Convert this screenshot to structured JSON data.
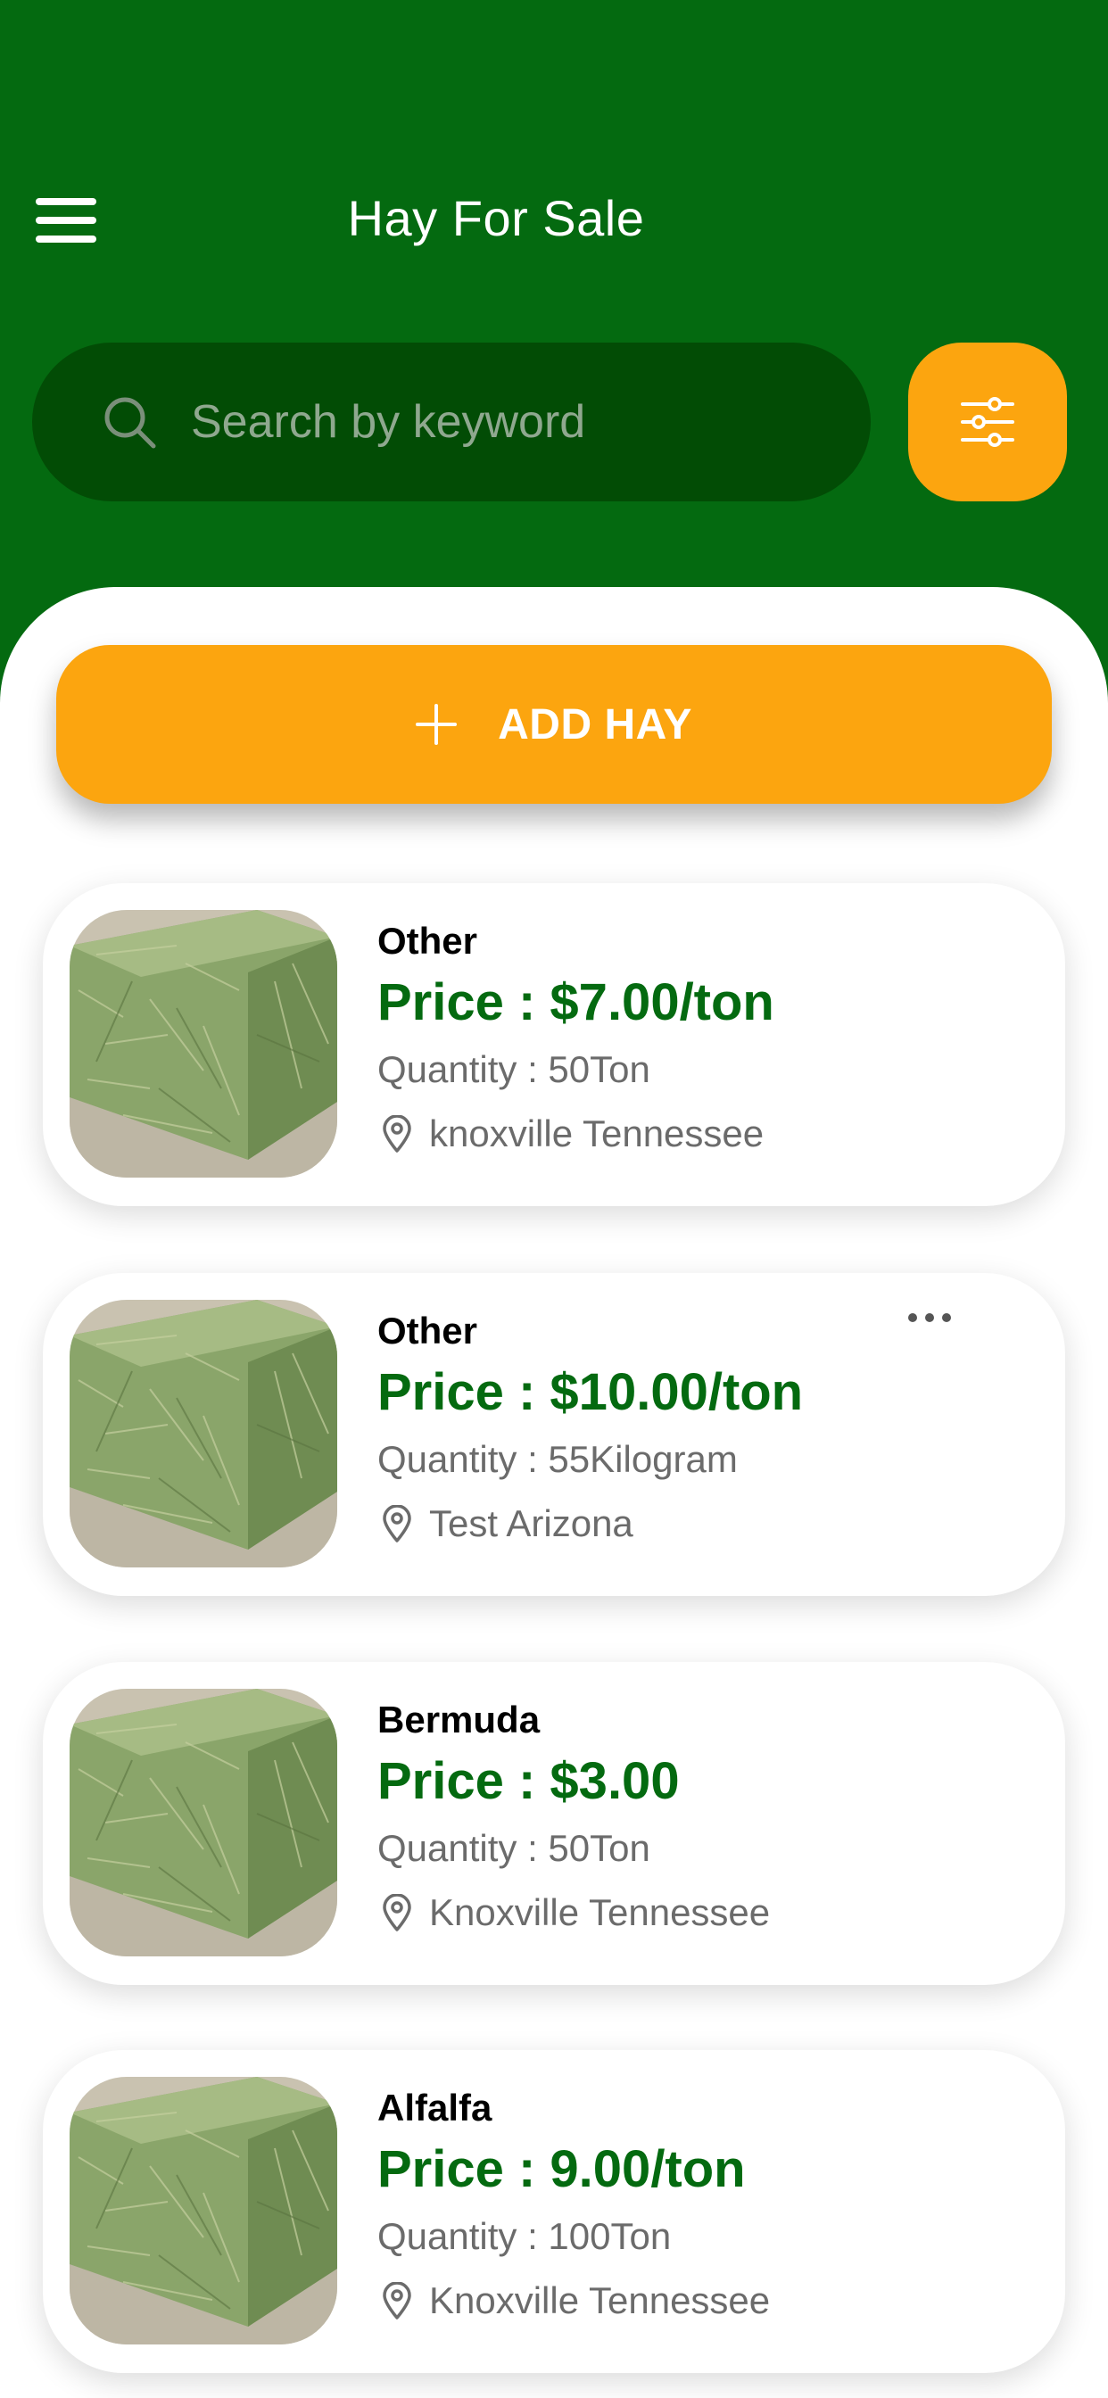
{
  "header": {
    "title": "Hay For Sale",
    "menu_icon": "hamburger-menu-icon"
  },
  "search": {
    "placeholder": "Search by keyword",
    "icon": "search-icon",
    "filter_icon": "filter-sliders-icon"
  },
  "add_button": {
    "label": "ADD HAY",
    "icon": "plus-icon"
  },
  "listings": [
    {
      "type": "Other",
      "price": "Price : $7.00/ton",
      "quantity": "Quantity : 50Ton",
      "location": "knoxville Tennessee",
      "has_menu": false
    },
    {
      "type": "Other",
      "price": "Price : $10.00/ton",
      "quantity": "Quantity : 55Kilogram",
      "location": "Test Arizona",
      "has_menu": true
    },
    {
      "type": "Bermuda",
      "price": "Price : $3.00",
      "quantity": "Quantity : 50Ton",
      "location": "Knoxville Tennessee",
      "has_menu": false
    },
    {
      "type": "Alfalfa",
      "price": "Price : 9.00/ton",
      "quantity": "Quantity : 100Ton",
      "location": "Knoxville Tennessee",
      "has_menu": false
    }
  ],
  "colors": {
    "primary_green": "#046a10",
    "search_bg": "#024c05",
    "accent_orange": "#fca50f",
    "text_gray": "#6b6b6b"
  }
}
